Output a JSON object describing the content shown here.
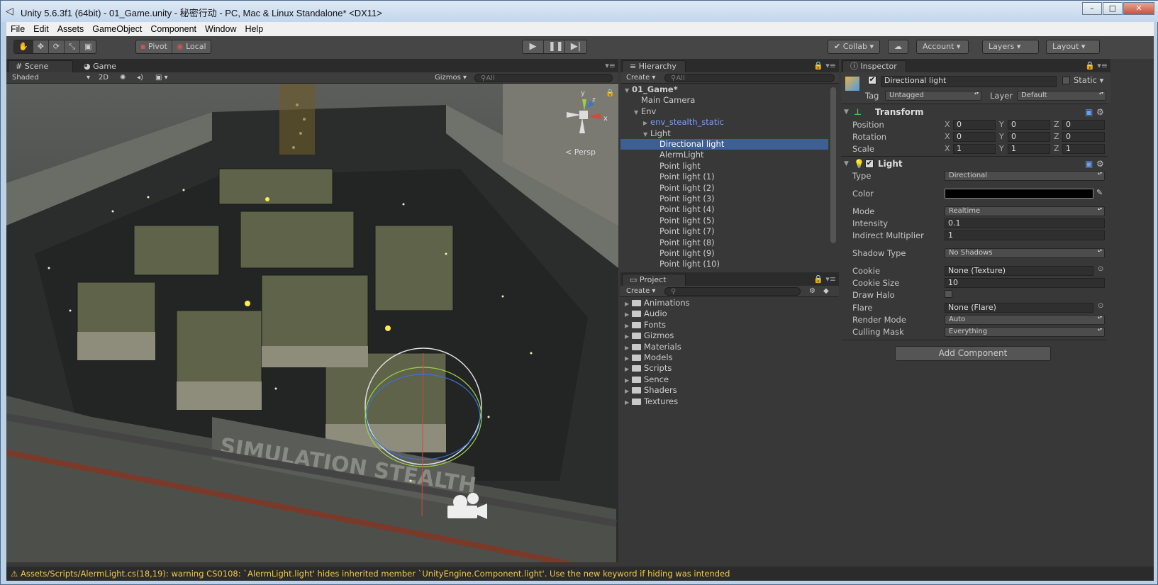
{
  "window": {
    "title": "Unity 5.6.3f1 (64bit) - 01_Game.unity - 秘密行动 - PC, Mac & Linux Standalone* <DX11>",
    "minimize": "0",
    "maximize": "1",
    "close": "r"
  },
  "menu": [
    "File",
    "Edit",
    "Assets",
    "GameObject",
    "Component",
    "Window",
    "Help"
  ],
  "toolbar": {
    "pivot": "Pivot",
    "local": "Local",
    "collab": "Collab",
    "account": "Account",
    "layers": "Layers",
    "layout": "Layout"
  },
  "scene": {
    "tab_scene": "Scene",
    "tab_game": "Game",
    "shading": "Shaded",
    "mode_2d": "2D",
    "gizmos": "Gizmos",
    "search_placeholder": "All",
    "persp": "Persp",
    "axis_y": "y",
    "axis_x": "x",
    "axis_z": "z"
  },
  "hierarchy": {
    "tab": "Hierarchy",
    "create": "Create",
    "search_placeholder": "All",
    "rows": [
      {
        "label": "01_Game*",
        "indent": 0,
        "arrow": "▼",
        "style": "bold"
      },
      {
        "label": "Main Camera",
        "indent": 1,
        "arrow": "",
        "style": ""
      },
      {
        "label": "Env",
        "indent": 1,
        "arrow": "▼",
        "style": ""
      },
      {
        "label": "env_stealth_static",
        "indent": 2,
        "arrow": "▶",
        "style": "prefab"
      },
      {
        "label": "Light",
        "indent": 2,
        "arrow": "▼",
        "style": ""
      },
      {
        "label": "Directional light",
        "indent": 3,
        "arrow": "",
        "style": "sel"
      },
      {
        "label": "AlermLight",
        "indent": 3,
        "arrow": "",
        "style": ""
      },
      {
        "label": "Point light",
        "indent": 3,
        "arrow": "",
        "style": ""
      },
      {
        "label": "Point light (1)",
        "indent": 3,
        "arrow": "",
        "style": ""
      },
      {
        "label": "Point light (2)",
        "indent": 3,
        "arrow": "",
        "style": ""
      },
      {
        "label": "Point light (3)",
        "indent": 3,
        "arrow": "",
        "style": ""
      },
      {
        "label": "Point light (4)",
        "indent": 3,
        "arrow": "",
        "style": ""
      },
      {
        "label": "Point light (5)",
        "indent": 3,
        "arrow": "",
        "style": ""
      },
      {
        "label": "Point light (7)",
        "indent": 3,
        "arrow": "",
        "style": ""
      },
      {
        "label": "Point light (8)",
        "indent": 3,
        "arrow": "",
        "style": ""
      },
      {
        "label": "Point light (9)",
        "indent": 3,
        "arrow": "",
        "style": ""
      },
      {
        "label": "Point light (10)",
        "indent": 3,
        "arrow": "",
        "style": ""
      }
    ]
  },
  "project": {
    "tab": "Project",
    "create": "Create",
    "folders": [
      "Animations",
      "Audio",
      "Fonts",
      "Gizmos",
      "Materials",
      "Models",
      "Scripts",
      "Sence",
      "Shaders",
      "Textures"
    ]
  },
  "inspector": {
    "tab": "Inspector",
    "object_name": "Directional light",
    "static_label": "Static",
    "tag_label": "Tag",
    "tag_value": "Untagged",
    "layer_label": "Layer",
    "layer_value": "Default",
    "transform": {
      "title": "Transform",
      "position_label": "Position",
      "rotation_label": "Rotation",
      "scale_label": "Scale",
      "position": [
        "0",
        "0",
        "0"
      ],
      "rotation": [
        "0",
        "0",
        "0"
      ],
      "scale": [
        "1",
        "1",
        "1"
      ]
    },
    "light": {
      "title": "Light",
      "type_label": "Type",
      "type_value": "Directional",
      "color_label": "Color",
      "color_value": "#000000",
      "mode_label": "Mode",
      "mode_value": "Realtime",
      "intensity_label": "Intensity",
      "intensity_value": "0.1",
      "indirect_label": "Indirect Multiplier",
      "indirect_value": "1",
      "shadow_label": "Shadow Type",
      "shadow_value": "No Shadows",
      "cookie_label": "Cookie",
      "cookie_value": "None (Texture)",
      "cookie_size_label": "Cookie Size",
      "cookie_size_value": "10",
      "draw_halo_label": "Draw Halo",
      "flare_label": "Flare",
      "flare_value": "None (Flare)",
      "render_mode_label": "Render Mode",
      "render_mode_value": "Auto",
      "culling_label": "Culling Mask",
      "culling_value": "Everything"
    },
    "add_component": "Add Component"
  },
  "status": {
    "message": "Assets/Scripts/AlermLight.cs(18,19): warning CS0108: `AlermLight.light' hides inherited member `UnityEngine.Component.light'. Use the new keyword if hiding was intended"
  },
  "colors": {
    "selection": "#3e5f96",
    "warning": "#f0c94e",
    "prefab": "#7aa2f0"
  }
}
